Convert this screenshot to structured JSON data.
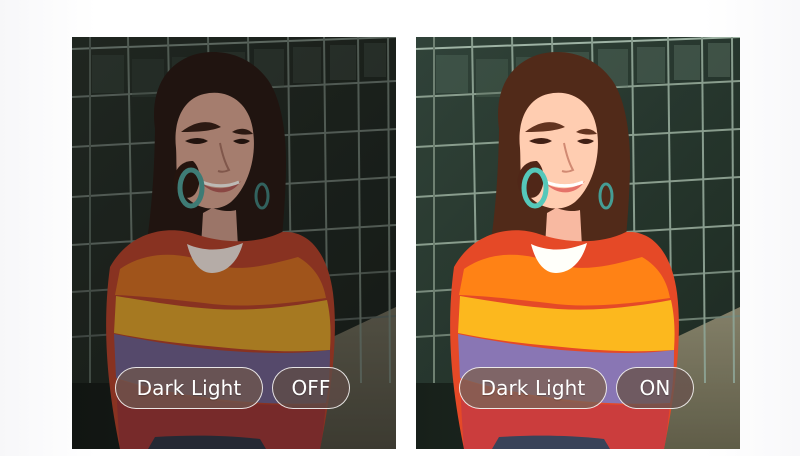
{
  "comparison": {
    "left": {
      "mode_label": "Dark Light",
      "state_label": "OFF"
    },
    "right": {
      "mode_label": "Dark Light",
      "state_label": "ON"
    }
  },
  "colors": {
    "background": "#ffffff",
    "pill_border": "#ffffff",
    "pill_text": "#ffffff",
    "off_pill_fill": "#5f4b46",
    "on_pill_fill": "#7d6256"
  },
  "images": [
    {
      "name": "portrait-dark-light-off"
    },
    {
      "name": "portrait-dark-light-on"
    }
  ]
}
